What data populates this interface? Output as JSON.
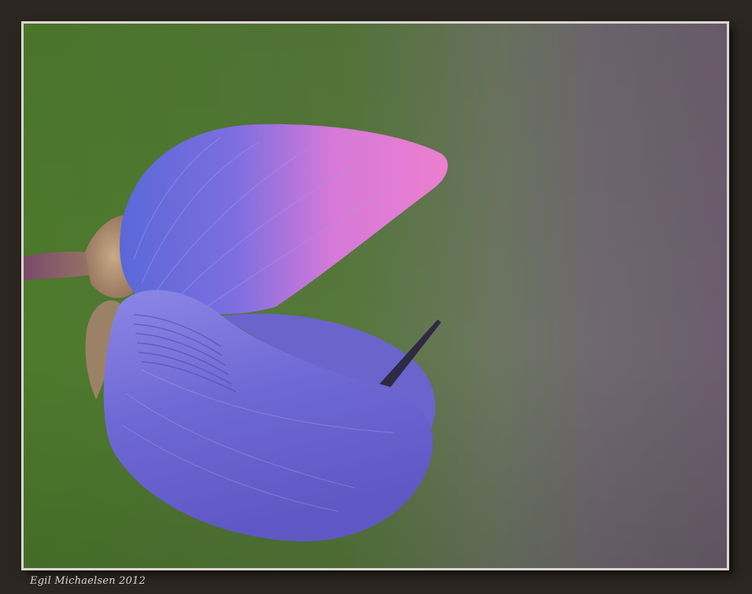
{
  "image": {
    "subject": "lupine-flower-macro",
    "signature_text": "Egil Michaelsen 2012",
    "colors": {
      "frame": "#2b261f",
      "border": "#d9d6d0",
      "bg_green": "#4f7a2e",
      "bg_mauve": "#6e5d6e",
      "petal_blue": "#6f6bd6",
      "petal_pink": "#e07ad0"
    }
  }
}
